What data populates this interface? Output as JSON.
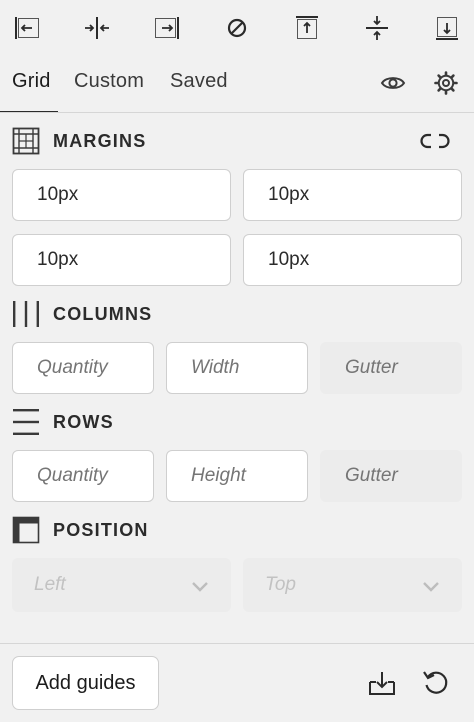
{
  "toolbar": {
    "buttons": [
      {
        "icon": "align-left-icon"
      },
      {
        "icon": "align-center-horizontal-icon"
      },
      {
        "icon": "align-right-icon"
      },
      {
        "icon": "no-alignment-icon"
      },
      {
        "icon": "align-top-icon"
      },
      {
        "icon": "align-center-vertical-icon"
      },
      {
        "icon": "align-bottom-icon"
      }
    ]
  },
  "tabs": [
    {
      "label": "Grid",
      "active": true
    },
    {
      "label": "Custom",
      "active": false
    },
    {
      "label": "Saved",
      "active": false
    }
  ],
  "tab_icons": [
    "eye-icon",
    "gear-icon"
  ],
  "margins": {
    "title": "MARGINS",
    "icon": "margins-grid-icon",
    "link_icon": "unlink-icon",
    "values": [
      "10px",
      "10px",
      "10px",
      "10px"
    ]
  },
  "columns": {
    "title": "COLUMNS",
    "icon": "columns-icon",
    "placeholders": [
      "Quantity",
      "Width",
      "Gutter"
    ]
  },
  "rows": {
    "title": "ROWS",
    "icon": "rows-icon",
    "placeholders": [
      "Quantity",
      "Height",
      "Gutter"
    ]
  },
  "position": {
    "title": "POSITION",
    "icon": "position-icon",
    "selects": [
      "Left",
      "Top"
    ]
  },
  "footer": {
    "add_label": "Add guides",
    "icons": [
      "import-icon",
      "reset-icon"
    ]
  },
  "colors": {
    "background": "#f1f1f1",
    "field_bg": "#ffffff",
    "border": "#cfcfcf",
    "disabled_bg": "#ececec",
    "text": "#2b2b2b",
    "placeholder": "#8a8a8a"
  }
}
